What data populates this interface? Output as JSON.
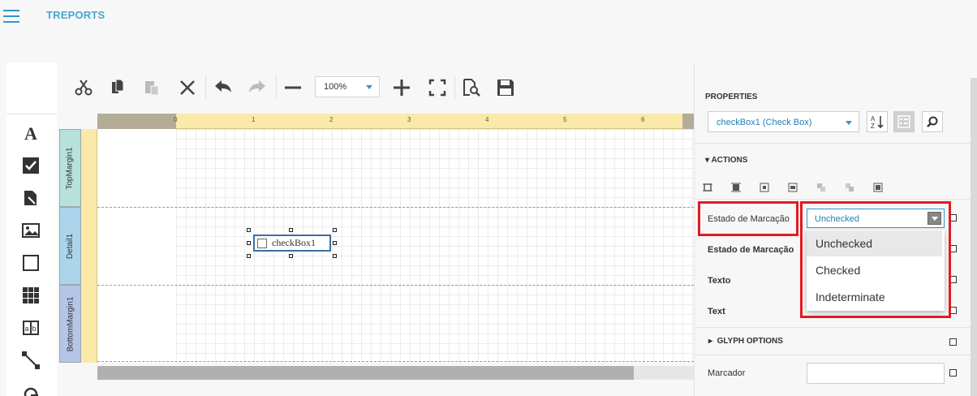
{
  "header": {
    "title": "TREPORTS"
  },
  "toolbox": {
    "items": [
      {
        "name": "label-tool-icon"
      },
      {
        "name": "checkbox-tool-icon"
      },
      {
        "name": "richtext-tool-icon"
      },
      {
        "name": "picture-tool-icon"
      },
      {
        "name": "panel-tool-icon"
      },
      {
        "name": "table-tool-icon"
      },
      {
        "name": "charactercomb-tool-icon"
      },
      {
        "name": "line-tool-icon"
      },
      {
        "name": "shape-tool-icon"
      }
    ]
  },
  "toolbar": {
    "zoom": "100%"
  },
  "surface": {
    "ruler_numbers": [
      "0",
      "1",
      "2",
      "3",
      "4",
      "5",
      "6"
    ],
    "bands": [
      "TopMargin1",
      "Detail1",
      "BottomMargin1"
    ],
    "control_text": "checkBox1"
  },
  "properties": {
    "title": "PROPERTIES",
    "selected_component": "checkBox1 (Check Box)",
    "actions_header": "ACTIONS",
    "rows": {
      "estado_marcacao_1": "Estado de Marcação",
      "estado_marcacao_2": "Estado de Marcação",
      "texto": "Texto",
      "text": "Text",
      "marcador": "Marcador"
    },
    "state_value": "Unchecked",
    "state_options": [
      "Unchecked",
      "Checked",
      "Indeterminate"
    ],
    "glyph_header": "GLYPH OPTIONS"
  },
  "colors": {
    "accent": "#2f97c8",
    "highlight": "#e21b22",
    "ruler": "#fbe9a9"
  }
}
